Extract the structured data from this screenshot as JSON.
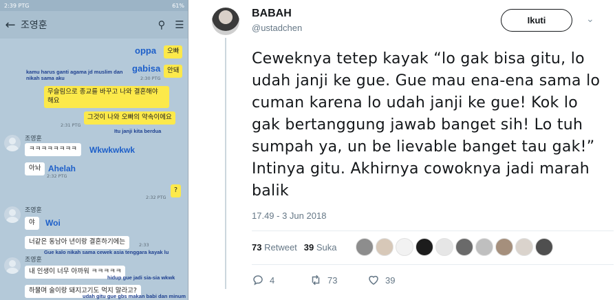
{
  "phone": {
    "status_time": "2:39 PTG",
    "status_battery": "61%",
    "chat_title": "조영훈",
    "messages": {
      "m1_en": "oppa",
      "m1_ko": "오빠",
      "m2_en": "gabisa",
      "m2_ko": "안돼",
      "m2_ts": "2:30 PTG",
      "m2_tr": "kamu harus ganti agama jd muslim dan nikah sama aku",
      "m3_ko": "무슬림으로 종교를 바꾸고 나와 결혼해야 해요",
      "m4_ko": "그것이 나와 오빠의 약속이에요",
      "m4_ts": "2:31 PTG",
      "m4_tr": "Itu janji kita berdua",
      "s1": "조영훈",
      "m5_ko": "ㅋㅋㅋㅋㅋㅋㅋㅋ",
      "m5_tr": "Wkwkwkwk",
      "m6_ko": "아놔",
      "m6_tr": "Ahelah",
      "m6_ts": "2:32 PTG",
      "m7_ko": "?",
      "m7_ts": "2:32 PTG",
      "s2": "조영훈",
      "m8_ko": "야",
      "m8_tr": "Woi",
      "m9_ko": "너같은 동남아 년이랑 결혼하기에는",
      "m9_ts": "2:33",
      "m9_tr": "Gue kalo nikah sama cewek asia tenggara kayak lu",
      "s3": "조영훈",
      "m10_ko": "내 인생이 너무 아까워 ㅋㅋㅋㅋㅋ",
      "m10_tr": "hidup gue jadi sia-sia wkwk",
      "m11_ko": "하물며 술이랑 돼지고기도 먹지 말라고?",
      "m11_tr": "udah gitu gue gbs makan babi dan minum"
    }
  },
  "tweet": {
    "display_name": "BABAH",
    "handle": "@ustadchen",
    "follow_label": "Ikuti",
    "text": "Ceweknya tetep kayak “lo gak bisa gitu, lo udah janji ke gue. Gue mau ena-ena sama lo cuman karena lo udah janji ke gue! Kok lo gak bertanggung jawab banget sih! Lo tuh sumpah ya, un be lievable banget tau gak!” Intinya gitu. Akhirnya cowoknya jadi marah balik",
    "timestamp": "17.49 - 3 Jun 2018",
    "retweets_count": "73",
    "retweets_label": "Retweet",
    "likes_count": "39",
    "likes_label": "Suka",
    "action_reply_count": "4",
    "action_retweet_count": "73",
    "action_like_count": "39",
    "icons": [
      "reply-icon",
      "retweet-icon",
      "heart-icon",
      "more-icon"
    ]
  }
}
